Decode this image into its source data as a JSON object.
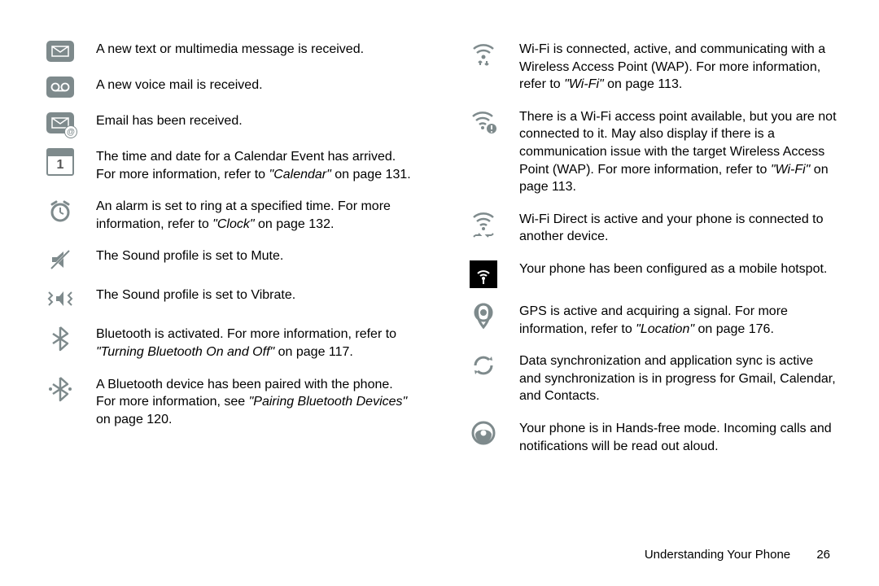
{
  "left": [
    {
      "icon": "message-icon",
      "text": "A new text or multimedia message is received."
    },
    {
      "icon": "voicemail-icon",
      "text": "A new voice mail is received."
    },
    {
      "icon": "email-icon",
      "text": "Email has been received."
    },
    {
      "icon": "calendar-icon",
      "text": "The time and date for a Calendar Event has arrived. For more information, refer to ",
      "ref": "\"Calendar\"",
      "after": " on page 131."
    },
    {
      "icon": "alarm-icon",
      "text": "An alarm is set to ring at a specified time. For more information, refer to ",
      "ref": "\"Clock\"",
      "after": " on page 132."
    },
    {
      "icon": "mute-icon",
      "text": "The Sound profile is set to Mute."
    },
    {
      "icon": "vibrate-icon",
      "text": "The Sound profile is set to Vibrate."
    },
    {
      "icon": "bluetooth-icon",
      "text": "Bluetooth is activated. For more information, refer to ",
      "ref": "\"Turning Bluetooth On and Off\"",
      "after": " on page 117."
    },
    {
      "icon": "bluetooth-paired-icon",
      "text": "A Bluetooth device has been paired with the phone. For more information, see ",
      "ref": "\"Pairing Bluetooth Devices\"",
      "after": " on page 120."
    }
  ],
  "right": [
    {
      "icon": "wifi-active-icon",
      "text": "Wi-Fi is connected, active, and communicating with a Wireless Access Point (WAP). For more information, refer to ",
      "ref": "\"Wi-Fi\"",
      "after": " on page 113."
    },
    {
      "icon": "wifi-alert-icon",
      "text": "There is a Wi-Fi access point available, but you are not connected to it. May also display if there is a communication issue with the target Wireless Access Point (WAP). For more information, refer to ",
      "ref": "\"Wi-Fi\"",
      "after": " on page 113."
    },
    {
      "icon": "wifi-direct-icon",
      "text": "Wi-Fi Direct is active and your phone is connected to another device."
    },
    {
      "icon": "hotspot-icon",
      "text": "Your phone has been configured as a mobile hotspot."
    },
    {
      "icon": "gps-icon",
      "text": "GPS is active and acquiring a signal. For more information, refer to ",
      "ref": "\"Location\"",
      "after": " on page 176."
    },
    {
      "icon": "sync-icon",
      "text": "Data synchronization and application sync is active and synchronization is in progress for Gmail, Calendar, and Contacts."
    },
    {
      "icon": "handsfree-icon",
      "text": "Your phone is in Hands-free mode. Incoming calls and notifications will be read out aloud."
    }
  ],
  "calendar_day": "1",
  "footer": {
    "section": "Understanding Your Phone",
    "page": "26"
  }
}
